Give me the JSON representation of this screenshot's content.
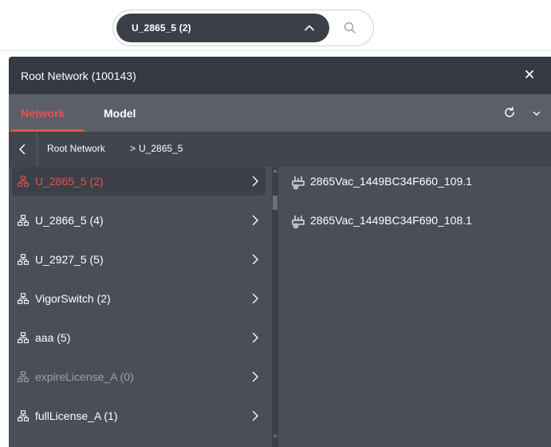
{
  "search": {
    "selected_value": "U_2865_5 (2)"
  },
  "panel": {
    "title": "Root Network (100143)",
    "tabs": [
      {
        "label": "Network",
        "active": true
      },
      {
        "label": "Model",
        "active": false
      }
    ],
    "breadcrumb": [
      "Root Network",
      "U_2865_5"
    ],
    "breadcrumb_separator": ">"
  },
  "networks": [
    {
      "label": "U_2865_5 (2)",
      "state": "selected"
    },
    {
      "label": "U_2866_5 (4)",
      "state": "normal"
    },
    {
      "label": "U_2927_5 (5)",
      "state": "normal"
    },
    {
      "label": "VigorSwitch (2)",
      "state": "normal"
    },
    {
      "label": "aaa (5)",
      "state": "normal"
    },
    {
      "label": "expireLicense_A (0)",
      "state": "disabled"
    },
    {
      "label": "fullLicense_A (1)",
      "state": "normal"
    }
  ],
  "devices": [
    {
      "label": "2865Vac_1449BC34F660_109.1",
      "icon": "router-icon",
      "status": "offline"
    },
    {
      "label": "2865Vac_1449BC34F690_108.1",
      "icon": "router-icon",
      "status": "offline"
    }
  ],
  "colors": {
    "accent": "#e8504f",
    "panel_bg": "#4a4e57",
    "header_bg": "#353942",
    "tabs_bg": "#5b5f68",
    "selected_bg": "#3c4048",
    "offline_dot": "#b9bcc2"
  }
}
